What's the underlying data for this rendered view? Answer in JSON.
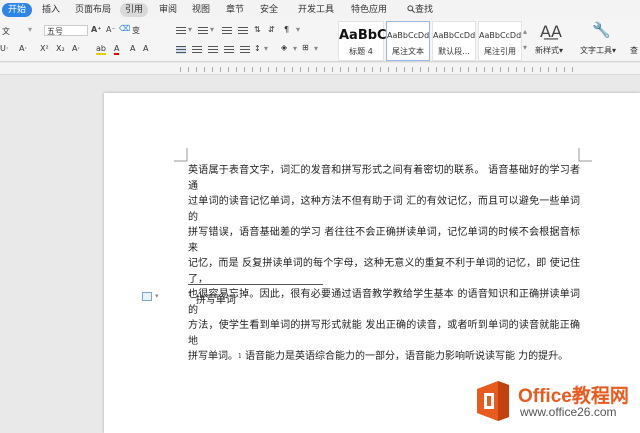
{
  "tabs": [
    "开始",
    "插入",
    "页面布局",
    "引用",
    "审阅",
    "视图",
    "章节",
    "安全",
    "开发工具",
    "特色应用",
    "查找"
  ],
  "ribbon": {
    "font_name": "文",
    "font_size": "五号",
    "styles": [
      {
        "sample": "AaBbC",
        "name": "标题 4"
      },
      {
        "sample": "AaBbCcDd",
        "name": "尾注文本"
      },
      {
        "sample": "AaBbCcDd",
        "name": "默认段..."
      },
      {
        "sample": "AaBbCcDd",
        "name": "尾注引用"
      }
    ],
    "new_style": "新样式",
    "text_tools": "文字工具",
    "find_replace": "查"
  },
  "document": {
    "lines": [
      "英语属于表音文字，词汇的发音和拼写形式之间有着密切的联系。 语音基础好的学习者通",
      "过单词的读音记忆单词，这种方法不但有助于词 汇的有效记忆，而且可以避免一些单词的",
      "拼写错误，语音基础差的学习 者往往不会正确拼读单词，记忆单词的时候不会根据音标来",
      "记忆，而是 反复拼读单词的每个字母，这种无意义的重复不利于单词的记忆，即 使记住了，",
      "也很容易忘掉。因此，很有必要通过语音教学教给学生基本 的语音知识和正确拼读单词的",
      "方法，使学生看到单词的拼写形式就能 发出正确的读音，或者听到单词的读音就能正确地",
      "拼写单词。",
      " 语音能力是英语综合能力的一部分，语音能力影响听说读写能 力的提升。"
    ],
    "note_mark": "1",
    "footnote_mark": "1",
    "footnote_text": "拼写单词"
  },
  "watermark": {
    "brand": "Office教程网",
    "url": "www.office26.com"
  },
  "colors": {
    "accent": "#2f84e7",
    "watermark": "#e85a1e"
  }
}
